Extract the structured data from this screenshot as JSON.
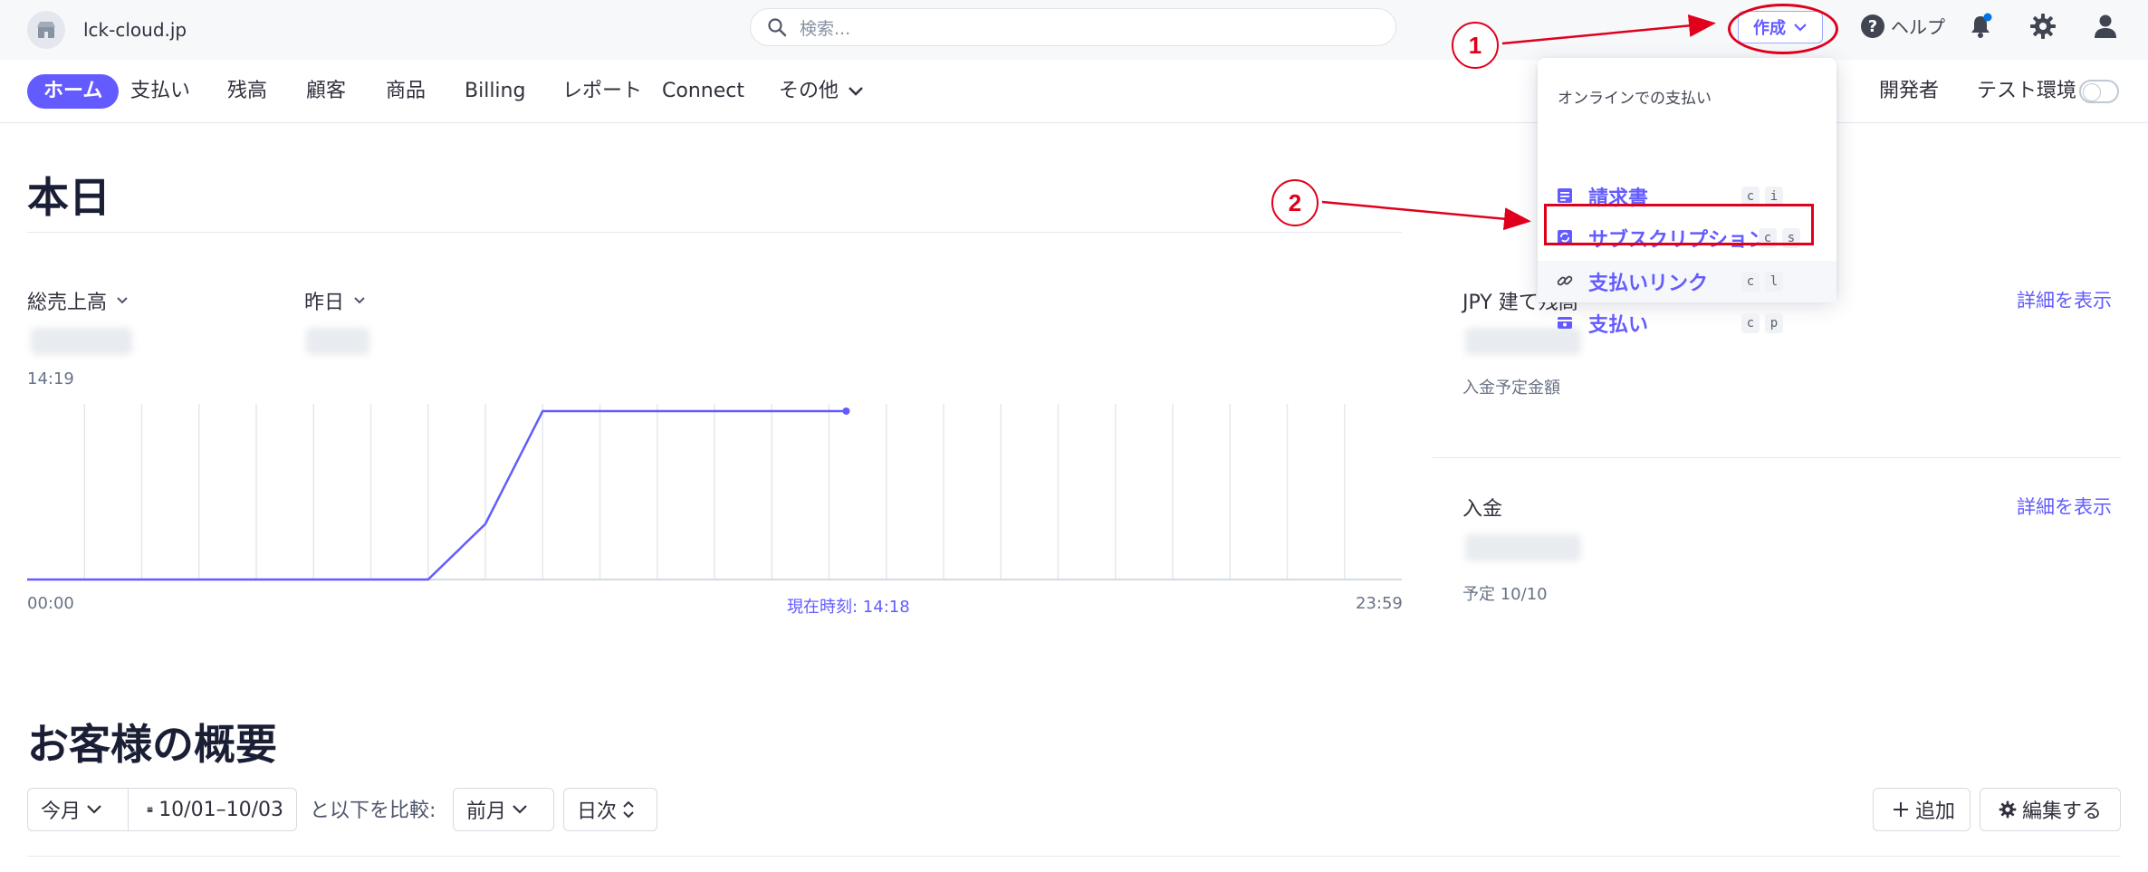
{
  "topbar": {
    "account_name": "lck-cloud.jp",
    "search_placeholder": "検索...",
    "create_label": "作成",
    "help_label": "ヘルプ"
  },
  "nav": {
    "items": [
      "ホーム",
      "支払い",
      "残高",
      "顧客",
      "商品",
      "Billing",
      "レポート",
      "Connect",
      "その他"
    ],
    "developers_label": "開発者",
    "test_mode_label": "テスト環境",
    "test_mode_on": false
  },
  "today": {
    "title": "本日",
    "gross_volume_label": "総売上高",
    "yesterday_label": "昨日",
    "current_time": "14:19",
    "chart_start": "00:00",
    "chart_now_label": "現在時刻: 14:18",
    "chart_end": "23:59"
  },
  "chart_data": {
    "type": "line",
    "x": [
      "00:00",
      "01:00",
      "02:00",
      "03:00",
      "04:00",
      "05:00",
      "06:00",
      "07:00",
      "08:00",
      "09:00",
      "10:00",
      "11:00",
      "12:00",
      "13:00",
      "14:00",
      "14:18"
    ],
    "series": [
      {
        "values": [
          0,
          0,
          0,
          0,
          0,
          0,
          0,
          0,
          0.33,
          1,
          1,
          1,
          1,
          1,
          1,
          1
        ]
      }
    ],
    "xlabel": "",
    "ylabel": "",
    "grid": true,
    "color": "#635bff"
  },
  "balance": {
    "title": "JPY 建て残高",
    "details_link": "詳細を表示",
    "sub_label": "入金予定金額"
  },
  "payouts": {
    "title": "入金",
    "details_link": "詳細を表示",
    "sub_label": "予定 10/10"
  },
  "overview": {
    "title": "お客様の概要",
    "period_select": "今月",
    "date_range": "10/01–10/03",
    "compare_text": "と以下を比較:",
    "compare_select": "前月",
    "interval_select": "日次",
    "add_label": "追加",
    "edit_label": "編集する"
  },
  "create_menu": {
    "heading": "オンラインでの支払い",
    "items": [
      {
        "label": "請求書",
        "key1": "c",
        "key2": "i"
      },
      {
        "label": "サブスクリプション",
        "key1": "c",
        "key2": "s"
      },
      {
        "label": "支払いリンク",
        "key1": "c",
        "key2": "l"
      },
      {
        "label": "支払い",
        "key1": "c",
        "key2": "p"
      }
    ]
  },
  "annotations": {
    "step1": "1",
    "step2": "2",
    "color": "#e0001b"
  },
  "colors": {
    "accent": "#635bff",
    "topbar_bg": "#f6f8fa",
    "annotation_red": "#e0001b"
  }
}
